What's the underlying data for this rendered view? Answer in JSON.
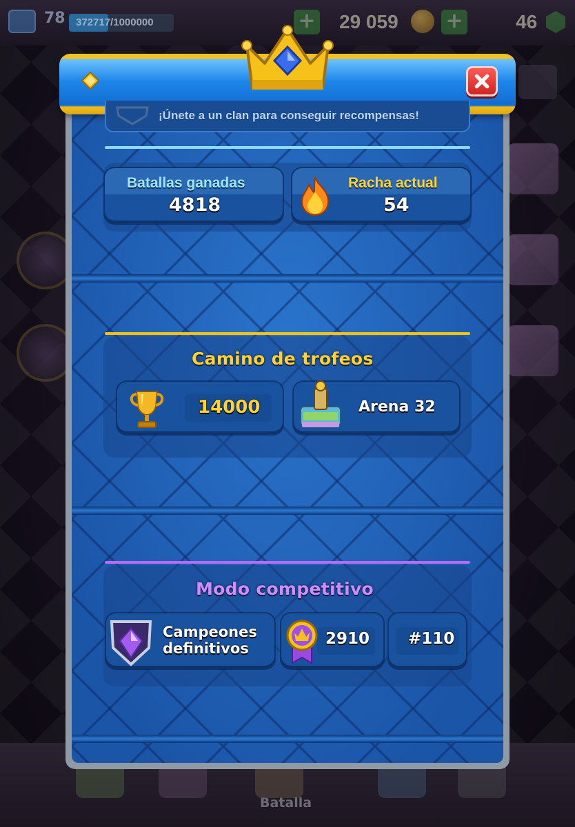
{
  "colors": {
    "gold_label": "#ffd231",
    "blue_label": "#9ee5ff",
    "purple_label": "#cf8cff",
    "trophy_divider": "#f4c20f",
    "competitive_divider": "#b56cf4",
    "stats_divider": "#8fd8ff"
  },
  "top_bar": {
    "level": "78",
    "xp": "372717/1000000",
    "xp_progress": 0.3727,
    "gold": "29 059",
    "gems": "46"
  },
  "modal": {
    "clan_banner": "¡Únete a un clan para conseguir recompensas!",
    "stats": {
      "battles_won_label": "Batallas ganadas",
      "battles_won_value": "4818",
      "streak_label": "Racha actual",
      "streak_value": "54"
    },
    "trophy_road": {
      "title": "Camino de trofeos",
      "trophies": "14000",
      "arena": "Arena 32"
    },
    "competitive": {
      "title": "Modo competitivo",
      "league": "Campeones definitivos",
      "league_line1": "Campeones",
      "league_line2": "definitivos",
      "rating": "2910",
      "rank": "#110"
    }
  },
  "bottom_nav": {
    "active_tab": "Batalla"
  }
}
